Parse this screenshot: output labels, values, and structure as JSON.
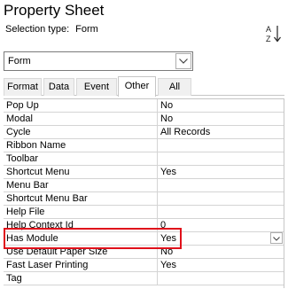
{
  "panel": {
    "title": "Property Sheet",
    "selection_label": "Selection type:",
    "selection_value": "Form",
    "sort_icon": "sort-az-icon"
  },
  "combo": {
    "value": "Form",
    "dropdown_icon": "chevron-down-icon"
  },
  "tabs": [
    {
      "label": "Format",
      "active": false
    },
    {
      "label": "Data",
      "active": false
    },
    {
      "label": "Event",
      "active": false
    },
    {
      "label": "Other",
      "active": true
    },
    {
      "label": "All",
      "active": false
    }
  ],
  "properties": [
    {
      "label": "Pop Up",
      "value": "No"
    },
    {
      "label": "Modal",
      "value": "No"
    },
    {
      "label": "Cycle",
      "value": "All Records"
    },
    {
      "label": "Ribbon Name",
      "value": ""
    },
    {
      "label": "Toolbar",
      "value": ""
    },
    {
      "label": "Shortcut Menu",
      "value": "Yes"
    },
    {
      "label": "Menu Bar",
      "value": ""
    },
    {
      "label": "Shortcut Menu Bar",
      "value": ""
    },
    {
      "label": "Help File",
      "value": ""
    },
    {
      "label": "Help Context Id",
      "value": "0"
    },
    {
      "label": "Has Module",
      "value": "Yes"
    },
    {
      "label": "Use Default Paper Size",
      "value": "No"
    },
    {
      "label": "Fast Laser Printing",
      "value": "Yes"
    },
    {
      "label": "Tag",
      "value": ""
    }
  ],
  "colors": {
    "highlight_border": "#e0101a",
    "grid_line": "#d4d4d4"
  }
}
